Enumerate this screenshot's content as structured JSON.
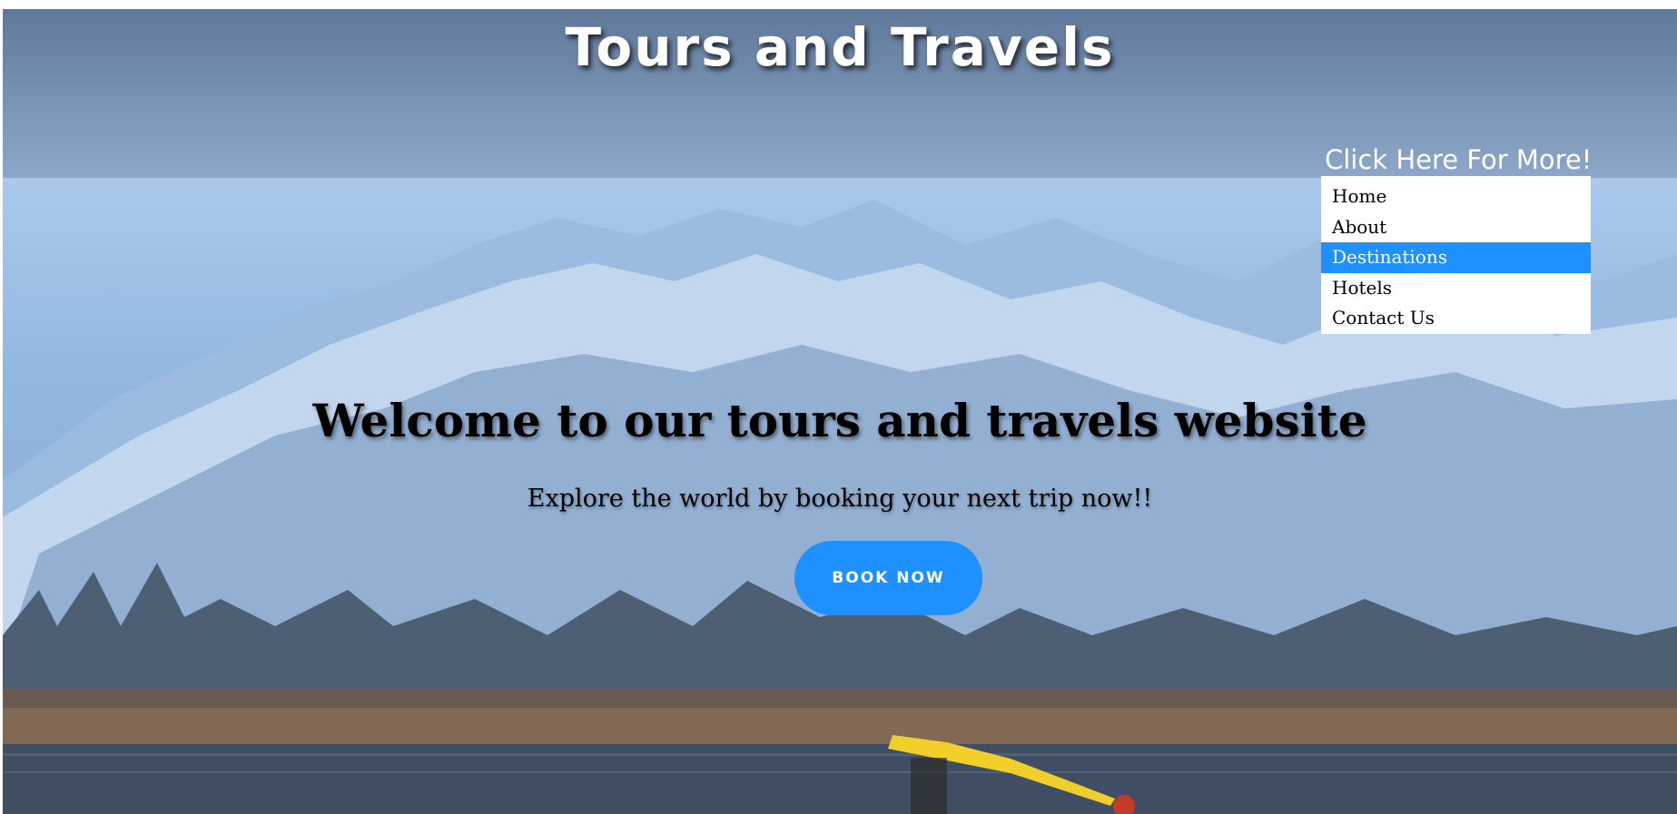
{
  "header": {
    "title": "Tours and Travels"
  },
  "dropdown": {
    "toggle_label": "Click Here For More!",
    "items": [
      {
        "label": "Home"
      },
      {
        "label": "About"
      },
      {
        "label": "Destinations"
      },
      {
        "label": "Hotels"
      },
      {
        "label": "Contact Us"
      }
    ]
  },
  "hero": {
    "heading": "Welcome to our tours and travels website",
    "subheading": "Explore the world by booking your next trip now!!",
    "cta_label": "BOOK NOW",
    "background_image": "snowy-mountains-lake-houseboats-shikara"
  },
  "colors": {
    "accent": "#1e90ff",
    "header_overlay": "#6f86a8",
    "menu_background": "#ffffff"
  }
}
